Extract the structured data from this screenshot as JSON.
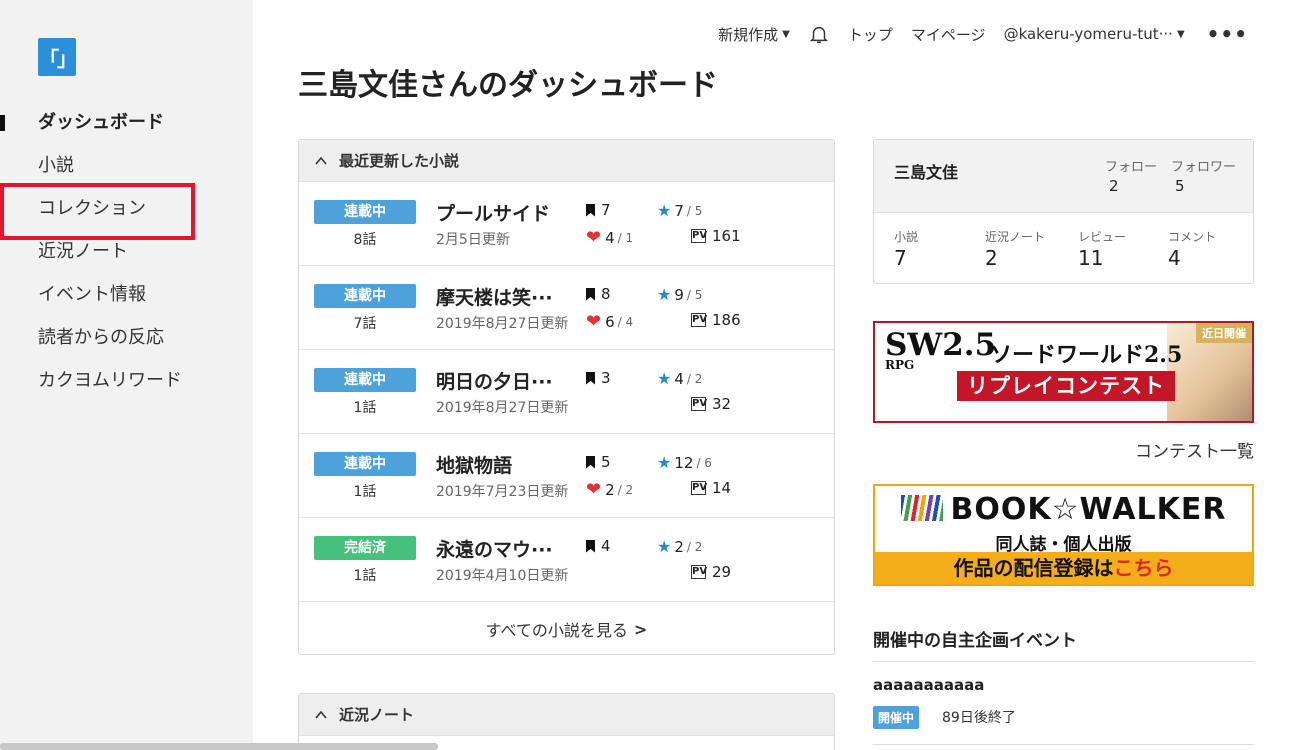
{
  "sidebar": {
    "logo": "「」",
    "items": [
      {
        "label": "ダッシュボード",
        "active": true
      },
      {
        "label": "小説"
      },
      {
        "label": "コレクション",
        "highlighted": true
      },
      {
        "label": "近況ノート"
      },
      {
        "label": "イベント情報"
      },
      {
        "label": "読者からの反応"
      },
      {
        "label": "カクヨムリワード"
      }
    ]
  },
  "topbar": {
    "new_label": "新規作成",
    "bell_icon": "bell-icon",
    "top_label": "トップ",
    "mypage_label": "マイページ",
    "user_label": "@kakeru-yomeru-tut···",
    "more_label": "•••"
  },
  "page_title": "三島文佳さんのダッシュボード",
  "novels_card": {
    "title": "最近更新した小説",
    "rows": [
      {
        "status": "連載中",
        "episodes": "8話",
        "title": "プールサイド",
        "updated": "2月5日更新",
        "bookmarks": "7",
        "stars": "7",
        "star_reviews": "/ 5",
        "hearts": "4",
        "heart_sub": "/ 1",
        "pv": "161",
        "done": false
      },
      {
        "status": "連載中",
        "episodes": "7話",
        "title": "摩天楼は笑···",
        "updated": "2019年8月27日更新",
        "bookmarks": "8",
        "stars": "9",
        "star_reviews": "/ 5",
        "hearts": "6",
        "heart_sub": "/ 4",
        "pv": "186",
        "done": false
      },
      {
        "status": "連載中",
        "episodes": "1話",
        "title": "明日の夕日···",
        "updated": "2019年8月27日更新",
        "bookmarks": "3",
        "stars": "4",
        "star_reviews": "/ 2",
        "hearts": "",
        "heart_sub": "",
        "pv": "32",
        "done": false
      },
      {
        "status": "連載中",
        "episodes": "1話",
        "title": "地獄物語",
        "updated": "2019年7月23日更新",
        "bookmarks": "5",
        "stars": "12",
        "star_reviews": "/ 6",
        "hearts": "2",
        "heart_sub": "/ 2",
        "pv": "14",
        "done": false
      },
      {
        "status": "完結済",
        "episodes": "1話",
        "title": "永遠のマウ···",
        "updated": "2019年4月10日更新",
        "bookmarks": "4",
        "stars": "2",
        "star_reviews": "/ 2",
        "hearts": "",
        "heart_sub": "",
        "pv": "29",
        "done": true
      }
    ],
    "see_all": "すべての小説を見る"
  },
  "notes_card": {
    "title": "近況ノート"
  },
  "profile": {
    "name": "三島文佳",
    "follow_label": "フォロー",
    "follow_count": "2",
    "follower_label": "フォロワー",
    "follower_count": "5",
    "stats": [
      {
        "label": "小説",
        "value": "7"
      },
      {
        "label": "近況ノート",
        "value": "2"
      },
      {
        "label": "レビュー",
        "value": "11"
      },
      {
        "label": "コメント",
        "value": "4"
      }
    ]
  },
  "banner_sw": {
    "logo_main": "SW2.5",
    "logo_sub": "RPG",
    "title": "ソードワールド2.5",
    "subtitle": "リプレイコンテスト",
    "tag": "近日開催"
  },
  "contest_link": "コンテスト一覧",
  "banner_bw": {
    "logo": "BOOK☆WALKER",
    "subtitle": "同人誌・個人出版",
    "cta_prefix": "作品の配信登録は",
    "cta_highlight": "こちら"
  },
  "events": {
    "title": "開催中の自主企画イベント",
    "event_name": "aaaaaaaaaaa",
    "badge": "開催中",
    "ends": "89日後終了"
  },
  "colors": {
    "accent": "#4da2dc",
    "done": "#45c17c",
    "highlight": "#e3162d"
  }
}
